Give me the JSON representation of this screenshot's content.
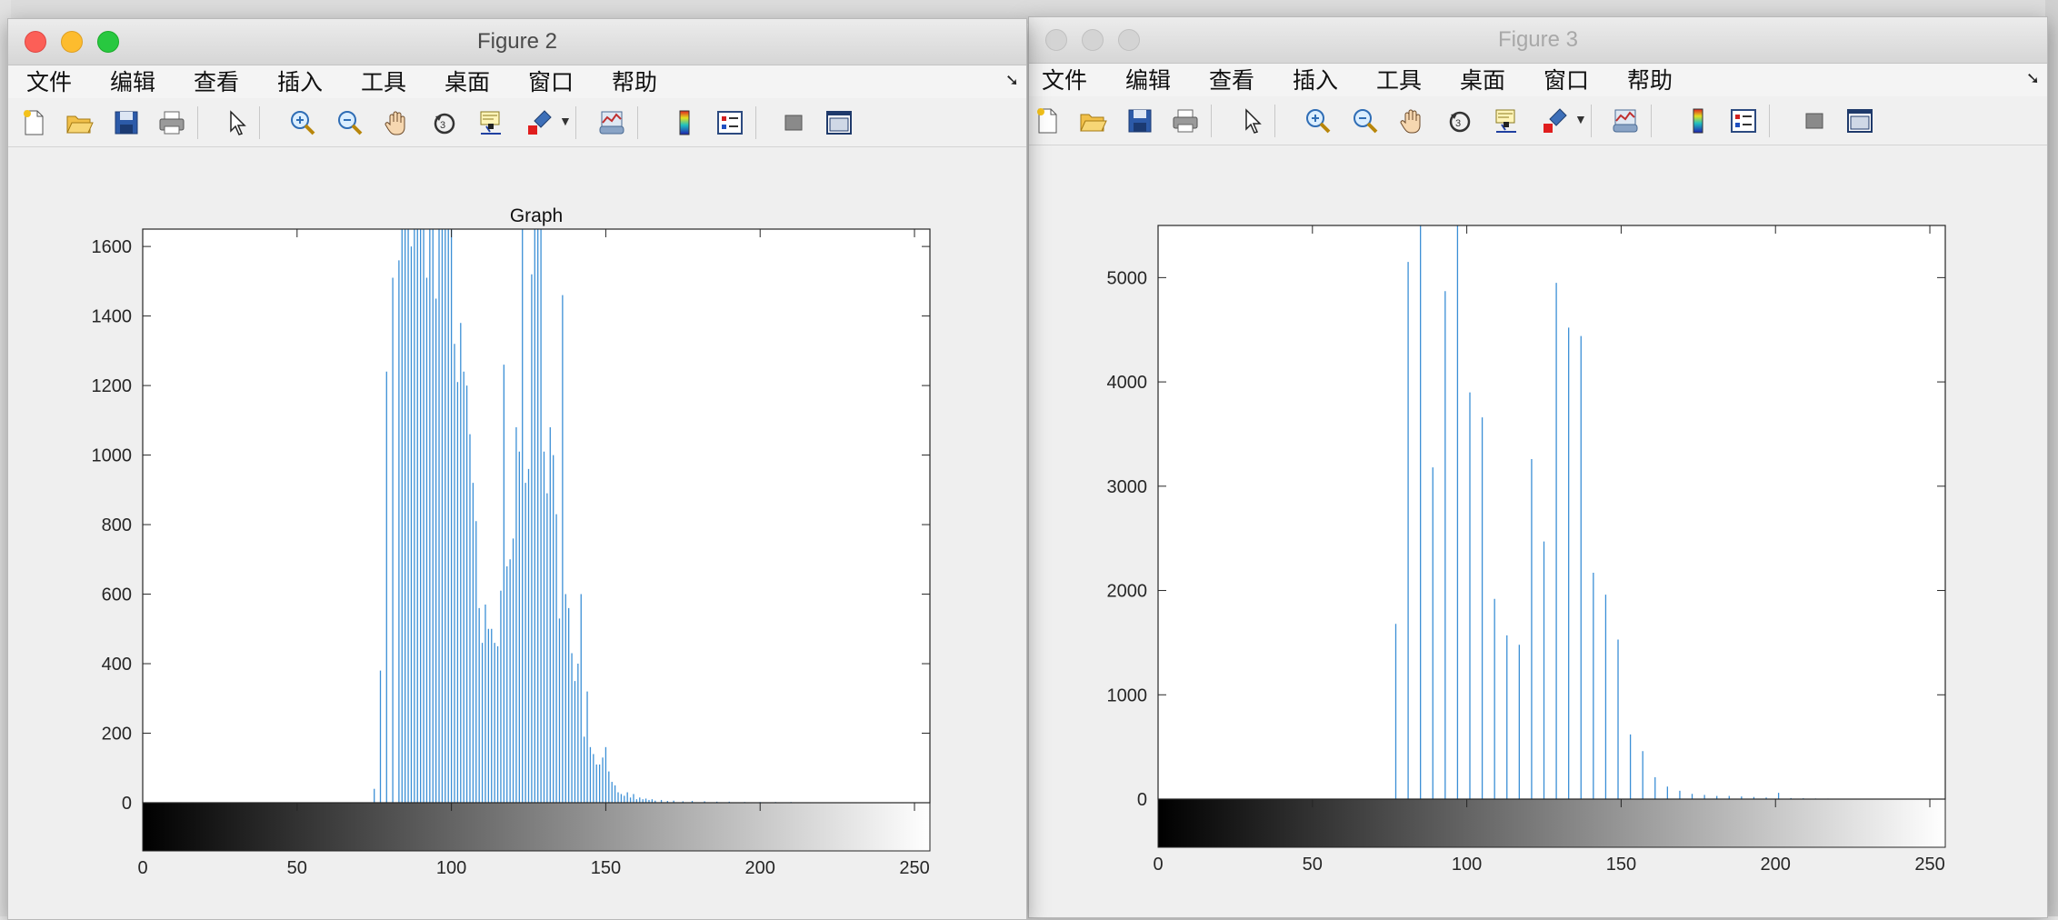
{
  "fig2": {
    "title": "Figure 2",
    "menu": [
      "文件",
      "编辑",
      "查看",
      "插入",
      "工具",
      "桌面",
      "窗口",
      "帮助"
    ]
  },
  "fig3": {
    "title": "Figure 3",
    "menu": [
      "文件",
      "编辑",
      "查看",
      "插入",
      "工具",
      "桌面",
      "窗口",
      "帮助"
    ]
  },
  "toolbar_icons": [
    "new-figure-icon",
    "open-file-icon",
    "save-icon",
    "print-icon",
    "edit-plot-pointer-icon",
    "zoom-in-icon",
    "zoom-out-icon",
    "pan-hand-icon",
    "rotate-3d-icon",
    "data-cursor-icon",
    "brush-icon",
    "link-plot-icon",
    "colorbar-icon",
    "legend-icon",
    "hide-plot-tools-icon",
    "show-plot-tools-icon"
  ],
  "colors": {
    "stem": "#3b8fd6",
    "axis": "#262626"
  },
  "chart_data": [
    {
      "type": "bar",
      "title": "Graph",
      "xlabel": "",
      "ylabel": "",
      "xlim": [
        0,
        255
      ],
      "ylim": [
        0,
        1650
      ],
      "xticks": [
        0,
        50,
        100,
        150,
        200,
        250
      ],
      "yticks": [
        0,
        200,
        400,
        600,
        800,
        1000,
        1200,
        1400,
        1600
      ],
      "colorbar": "grayscale 0-255",
      "x": [
        75,
        77,
        79,
        81,
        83,
        84,
        85,
        86,
        87,
        88,
        89,
        90,
        91,
        92,
        93,
        94,
        95,
        96,
        97,
        98,
        99,
        100,
        101,
        102,
        103,
        104,
        105,
        106,
        107,
        108,
        109,
        110,
        111,
        112,
        113,
        114,
        115,
        116,
        117,
        118,
        119,
        120,
        121,
        122,
        123,
        124,
        125,
        126,
        127,
        128,
        129,
        130,
        131,
        132,
        133,
        134,
        135,
        136,
        137,
        138,
        139,
        140,
        141,
        142,
        143,
        144,
        145,
        146,
        147,
        148,
        149,
        150,
        151,
        152,
        153,
        154,
        155,
        156,
        157,
        158,
        159,
        160,
        161,
        162,
        163,
        164,
        165,
        166,
        168,
        170,
        172,
        175,
        178,
        182,
        186,
        190,
        195,
        200,
        205,
        210,
        215,
        220
      ],
      "values": [
        40,
        380,
        1240,
        1510,
        1560,
        1650,
        1650,
        1650,
        1600,
        1650,
        1650,
        1650,
        1650,
        1510,
        1650,
        1650,
        1450,
        1650,
        1650,
        1650,
        1650,
        1650,
        1320,
        1210,
        1380,
        1240,
        1200,
        1060,
        920,
        810,
        560,
        460,
        570,
        500,
        500,
        460,
        450,
        610,
        1260,
        680,
        700,
        760,
        1080,
        1010,
        1650,
        920,
        960,
        1520,
        1650,
        1650,
        1650,
        1010,
        890,
        1080,
        1000,
        830,
        530,
        1460,
        600,
        560,
        430,
        350,
        400,
        600,
        190,
        320,
        160,
        140,
        110,
        110,
        130,
        160,
        90,
        60,
        50,
        30,
        25,
        20,
        30,
        15,
        25,
        10,
        15,
        10,
        12,
        8,
        10,
        6,
        8,
        5,
        6,
        4,
        5,
        4,
        3,
        3,
        2,
        2,
        2,
        2,
        1,
        1
      ]
    },
    {
      "type": "bar",
      "title": "",
      "xlabel": "",
      "ylabel": "",
      "xlim": [
        0,
        255
      ],
      "ylim": [
        0,
        5500
      ],
      "xticks": [
        0,
        50,
        100,
        150,
        200,
        250
      ],
      "yticks": [
        0,
        1000,
        2000,
        3000,
        4000,
        5000
      ],
      "colorbar": "grayscale 0-255",
      "x": [
        77,
        81,
        85,
        89,
        93,
        97,
        101,
        105,
        109,
        113,
        117,
        121,
        125,
        129,
        133,
        137,
        141,
        145,
        149,
        153,
        157,
        161,
        165,
        169,
        173,
        177,
        181,
        185,
        189,
        193,
        197,
        201,
        205,
        209,
        213,
        217,
        221
      ],
      "values": [
        1680,
        5150,
        5500,
        3180,
        4870,
        5500,
        3900,
        3660,
        1920,
        1570,
        1480,
        3260,
        2470,
        4950,
        4520,
        4440,
        2170,
        1960,
        1530,
        620,
        460,
        210,
        120,
        80,
        50,
        40,
        30,
        30,
        25,
        20,
        15,
        60,
        10,
        8,
        6,
        5,
        4
      ]
    }
  ]
}
